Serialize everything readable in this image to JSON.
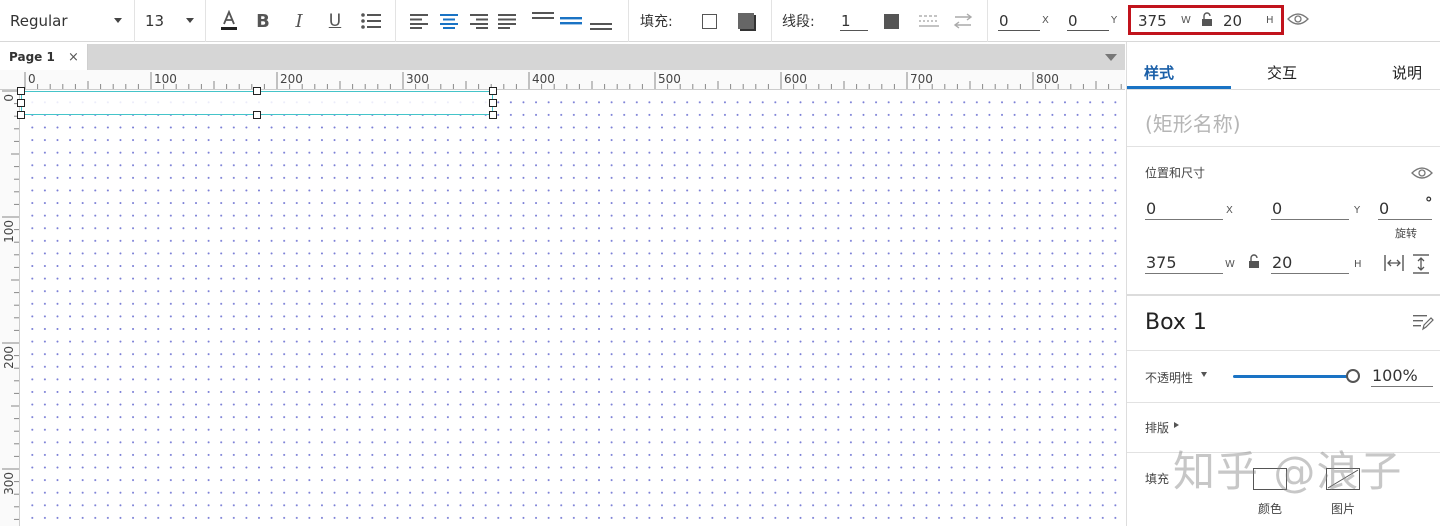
{
  "toolbar": {
    "font_weight": "Regular",
    "font_size": "13",
    "fill_label": "填充:",
    "line_label": "线段:",
    "line_width": "1",
    "x_value": "0",
    "x_label": "X",
    "y_value": "0",
    "y_label": "Y",
    "w_value": "375",
    "w_label": "W",
    "h_value": "20",
    "h_label": "H",
    "highlight_color": "#c1131c"
  },
  "tabs": {
    "page_tab": "Page 1",
    "close": "×"
  },
  "ruler": {
    "h_labels": [
      "0",
      "100",
      "200",
      "300",
      "400",
      "500",
      "600",
      "700",
      "800"
    ],
    "v_labels": [
      "0",
      "100",
      "200",
      "300"
    ]
  },
  "canvas": {
    "selection_color": "#45c4c9",
    "grid_dot_color": "#7b7fd6"
  },
  "panel": {
    "tabs": {
      "style": "样式",
      "interaction": "交互",
      "notes": "说明"
    },
    "name_placeholder": "(矩形名称)",
    "position_size_label": "位置和尺寸",
    "x_value": "0",
    "x_label": "X",
    "y_value": "0",
    "y_label": "Y",
    "rotation_value": "0",
    "rotation_unit": "°",
    "rotation_label": "旋转",
    "w_value": "375",
    "w_label": "W",
    "h_value": "20",
    "h_label": "H",
    "box_name": "Box 1",
    "opacity_label": "不透明性",
    "opacity_value": "100%",
    "layout_label": "排版",
    "fill_label": "填充",
    "fill_color_label": "颜色",
    "fill_image_label": "图片",
    "accent_color": "#1a73c4"
  },
  "watermark": "知乎 @浪子"
}
